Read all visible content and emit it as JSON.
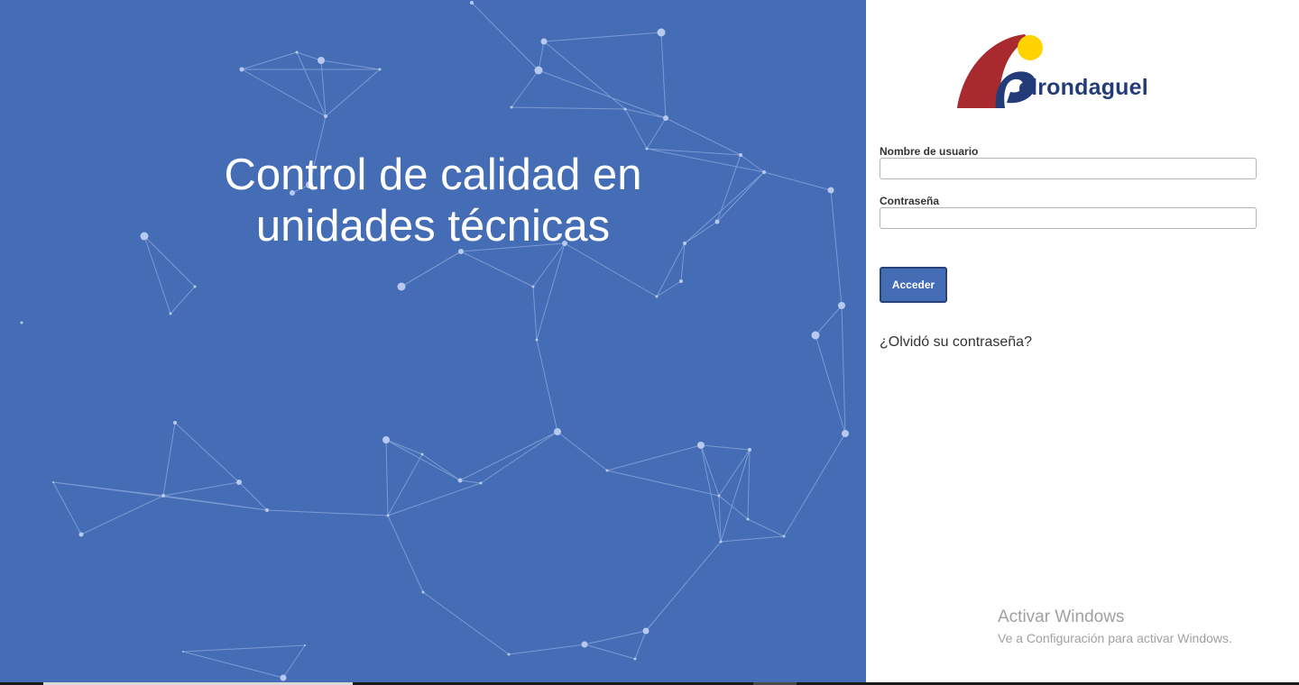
{
  "hero": {
    "title_line1": "Control de calidad en",
    "title_line2": "unidades técnicas",
    "background_color": "#446db5"
  },
  "brand": {
    "name": "elrondaguel",
    "colors": {
      "red": "#a82a2e",
      "yellow": "#ffd200",
      "navy": "#233b79"
    }
  },
  "login": {
    "username_label": "Nombre de usuario",
    "username_value": "",
    "password_label": "Contraseña",
    "password_value": "",
    "submit_label": "Acceder",
    "forgot_label": "¿Olvidó su contraseña?"
  },
  "watermark": {
    "title": "Activar Windows",
    "subtitle": "Ve a Configuración para activar Windows."
  }
}
